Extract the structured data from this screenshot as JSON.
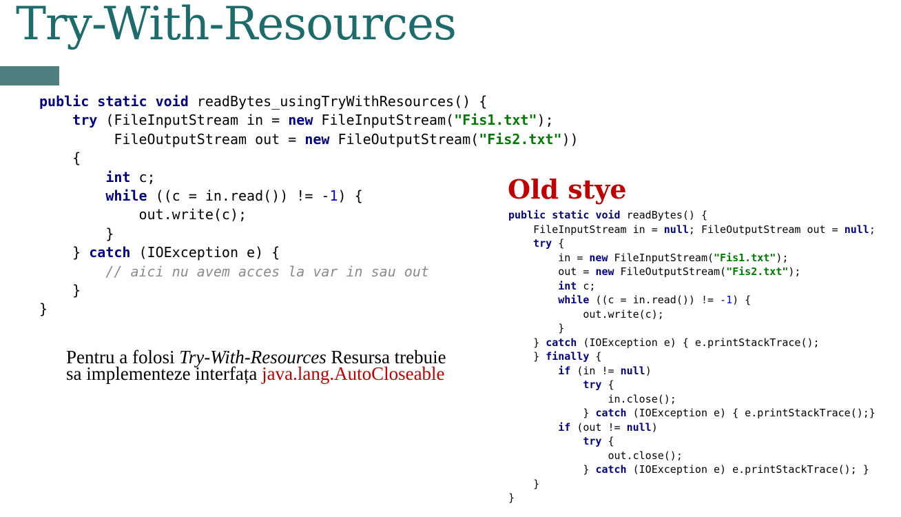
{
  "slide": {
    "title": "Try-With-Resources",
    "old_style_heading": "Old stye"
  },
  "colors": {
    "title": "#1e6b6b",
    "accent_bar": "#4f7f80",
    "keyword": "#000080",
    "string": "#007a00",
    "number": "#0000cc",
    "comment": "#8a8a8a",
    "highlight_red": "#c00000"
  },
  "note": {
    "part1": "Pentru a folosi ",
    "emphasis": "Try-With-Resources",
    "part2": " Resursa trebuie sa implementeze interfața ",
    "interface_name": "java.lang.AutoCloseable"
  },
  "code_new": [
    "public static void readBytes_usingTryWithResources() {",
    "    try (FileInputStream in = new FileInputStream(\"Fis1.txt\");",
    "         FileOutputStream out = new FileOutputStream(\"Fis2.txt\"))",
    "    {",
    "        int c;",
    "        while ((c = in.read()) != -1) {",
    "            out.write(c);",
    "        }",
    "    } catch (IOException e) {",
    "        // aici nu avem acces la var in sau out",
    "    }",
    "}"
  ],
  "code_old": [
    "public static void readBytes() {",
    "    FileInputStream in = null; FileOutputStream out = null;",
    "    try {",
    "        in = new FileInputStream(\"Fis1.txt\");",
    "        out = new FileOutputStream(\"Fis2.txt\");",
    "        int c;",
    "        while ((c = in.read()) != -1) {",
    "            out.write(c);",
    "        }",
    "    } catch (IOException e) { e.printStackTrace();",
    "    } finally {",
    "        if (in != null)",
    "            try {",
    "                in.close();",
    "            } catch (IOException e) { e.printStackTrace();}",
    "        if (out != null)",
    "            try {",
    "                out.close();",
    "            } catch (IOException e) e.printStackTrace(); }",
    "    }",
    "}"
  ]
}
